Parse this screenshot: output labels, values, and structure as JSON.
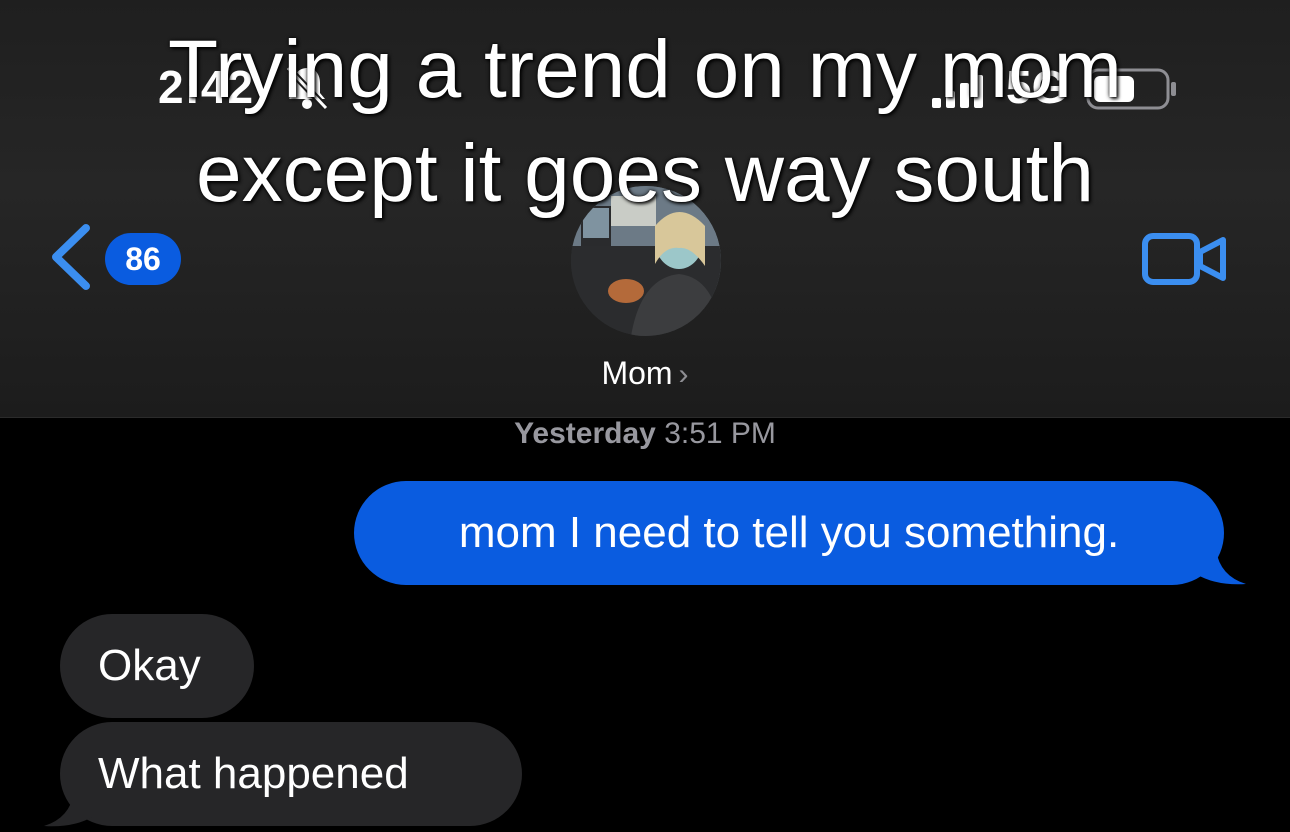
{
  "overlay": {
    "line1": "Trying a trend on my mom",
    "line2": "except it goes way south"
  },
  "status_bar": {
    "time": "2:42",
    "network": "5G",
    "icons": [
      "bell-slash-icon",
      "signal-bars-icon",
      "battery-icon"
    ]
  },
  "header": {
    "back_badge": "86",
    "contact_name": "Mom",
    "name_chevron": "›",
    "icons": [
      "back-chevron-icon",
      "video-call-icon",
      "contact-avatar"
    ]
  },
  "conversation": {
    "timestamp_day": "Yesterday",
    "timestamp_time": "3:51 PM",
    "messages": [
      {
        "from": "me",
        "text": "mom I need to tell you something."
      },
      {
        "from": "mom",
        "text": "Okay"
      },
      {
        "from": "mom",
        "text": "What happened"
      }
    ]
  },
  "colors": {
    "accent_blue": "#0a5ce0",
    "icon_blue": "#3b8ef0",
    "incoming_bubble": "#262628",
    "background": "#000000"
  }
}
